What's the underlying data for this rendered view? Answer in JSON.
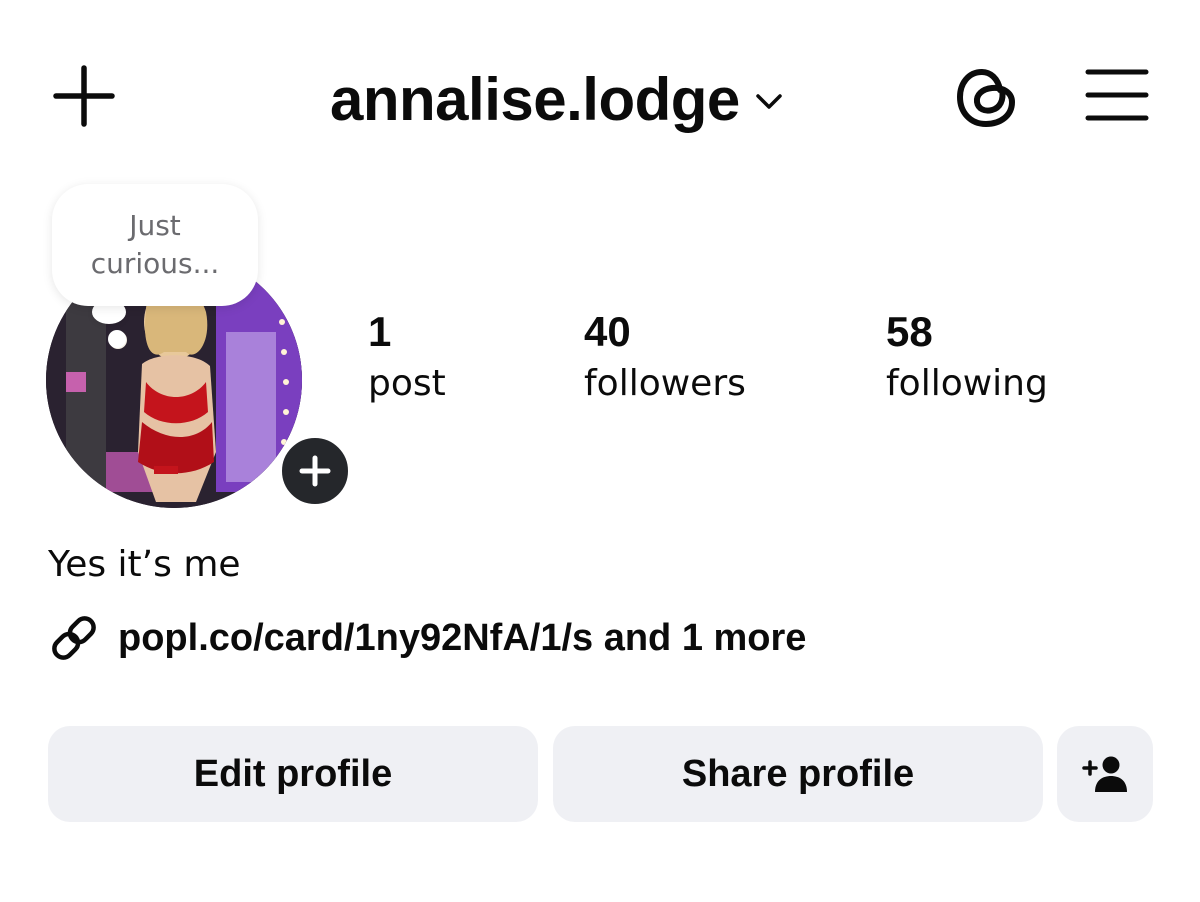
{
  "header": {
    "username": "annalise.lodge",
    "icons": {
      "create": "plus-icon",
      "account_switcher": "chevron-down-icon",
      "threads": "threads-icon",
      "menu": "hamburger-menu-icon"
    }
  },
  "profile": {
    "note": {
      "line1": "Just",
      "line2": "curious..."
    },
    "avatar_icon": "profile-photo",
    "add_story_icon": "plus-icon"
  },
  "stats": {
    "posts": {
      "count": "1",
      "label": "post"
    },
    "followers": {
      "count": "40",
      "label": "followers"
    },
    "following": {
      "count": "58",
      "label": "following"
    }
  },
  "bio": {
    "text": "Yes it’s me",
    "link_icon": "link-icon",
    "link_text": "popl.co/card/1ny92NfA/1/s and 1 more"
  },
  "actions": {
    "edit_profile": "Edit profile",
    "share_profile": "Share profile",
    "discover_people_icon": "add-person-icon"
  },
  "colors": {
    "text": "#0b0b0b",
    "button_bg": "#eff0f4",
    "note_text": "#6b6b6f",
    "story_badge": "#25272b"
  }
}
